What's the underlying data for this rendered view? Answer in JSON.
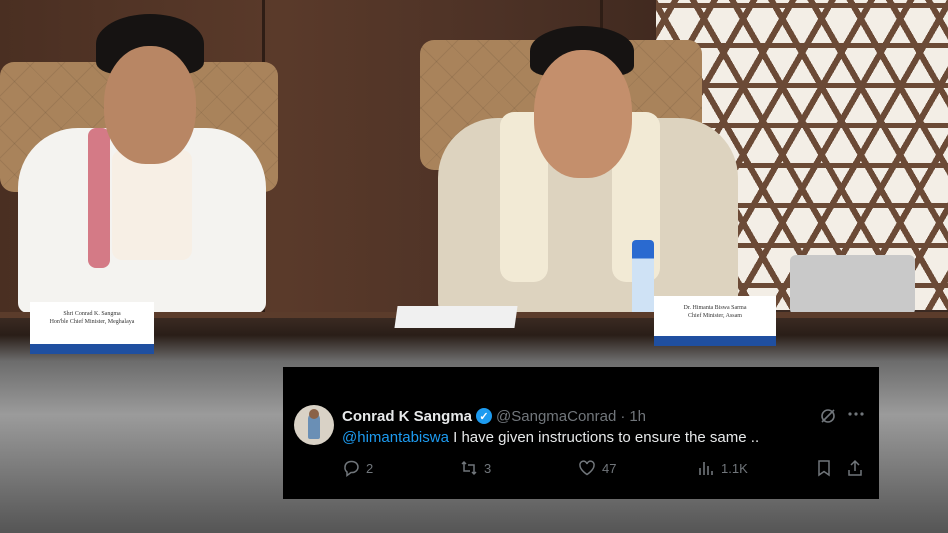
{
  "tweet": {
    "display_name": "Conrad K Sangma",
    "handle": "@SangmaConrad",
    "separator": "·",
    "time": "1h",
    "mention": "@himantabiswa",
    "text": " I have given instructions to ensure the same ..",
    "replies": "2",
    "reposts": "3",
    "likes": "47",
    "views": "1.1K",
    "icons": [
      "verified-badge-icon",
      "grok-icon",
      "more-icon",
      "reply-icon",
      "repost-icon",
      "like-icon",
      "views-icon",
      "bookmark-icon",
      "share-icon"
    ]
  },
  "photo": {
    "nameplate_left": "Shri Conrad K. Sangma\nHon'ble Chief Minister, Meghalaya",
    "nameplate_right": "Dr. Himanta Biswa Sarma\nChief Minister, Assam"
  },
  "colors": {
    "tweet_bg": "#000000",
    "text": "#e7e9ea",
    "muted": "#71767b",
    "accent": "#1d9bf0"
  }
}
